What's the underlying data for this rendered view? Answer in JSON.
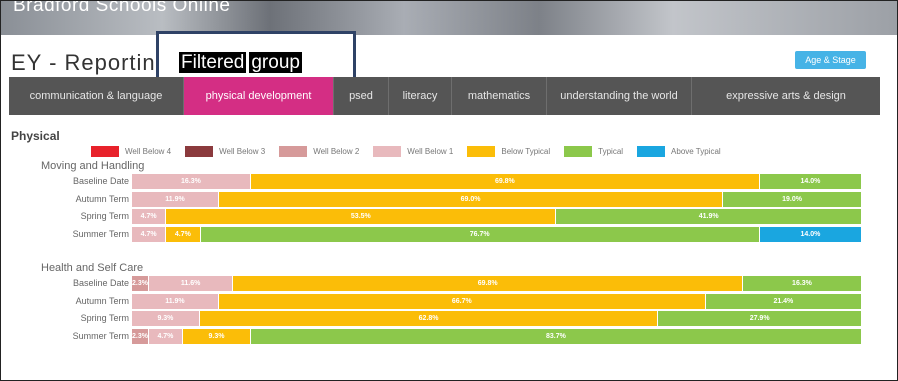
{
  "banner": {
    "site_name": "Bradford Schools Online"
  },
  "page": {
    "title": "EY - Reporting"
  },
  "callout": {
    "word1": "Filtered",
    "word2": "group"
  },
  "age_button": {
    "label": "Age & Stage"
  },
  "tabs": [
    {
      "label": "communication & language",
      "active": false
    },
    {
      "label": "physical development",
      "active": true
    },
    {
      "label": "psed",
      "active": false
    },
    {
      "label": "literacy",
      "active": false
    },
    {
      "label": "mathematics",
      "active": false
    },
    {
      "label": "understanding the world",
      "active": false
    },
    {
      "label": "expressive arts & design",
      "active": false
    }
  ],
  "section": {
    "title": "Physical"
  },
  "legend": [
    {
      "label": "Well Below 4",
      "color": "#e8222b"
    },
    {
      "label": "Well Below 3",
      "color": "#8b3a3d"
    },
    {
      "label": "Well Below 2",
      "color": "#d69a9a"
    },
    {
      "label": "Well Below 1",
      "color": "#e8b9bd"
    },
    {
      "label": "Below Typical",
      "color": "#fbbd08"
    },
    {
      "label": "Typical",
      "color": "#8cc84b"
    },
    {
      "label": "Above Typical",
      "color": "#1aa6e0"
    }
  ],
  "chart_data": {
    "type": "bar",
    "stacked": true,
    "orientation": "horizontal",
    "series_order": [
      "Well Below 4",
      "Well Below 3",
      "Well Below 2",
      "Well Below 1",
      "Below Typical",
      "Typical",
      "Above Typical"
    ],
    "groups": [
      {
        "name": "Moving and Handling",
        "rows": [
          {
            "label": "Baseline Date",
            "segments": [
              {
                "category": "Well Below 1",
                "value": 16.3,
                "text": "16.3%"
              },
              {
                "category": "Below Typical",
                "value": 69.8,
                "text": "69.8%"
              },
              {
                "category": "Typical",
                "value": 14.0,
                "text": "14.0%"
              }
            ]
          },
          {
            "label": "Autumn Term",
            "segments": [
              {
                "category": "Well Below 1",
                "value": 11.9,
                "text": "11.9%"
              },
              {
                "category": "Below Typical",
                "value": 69.0,
                "text": "69.0%"
              },
              {
                "category": "Typical",
                "value": 19.0,
                "text": "19.0%"
              }
            ]
          },
          {
            "label": "Spring Term",
            "segments": [
              {
                "category": "Well Below 1",
                "value": 4.7,
                "text": "4.7%"
              },
              {
                "category": "Below Typical",
                "value": 53.5,
                "text": "53.5%"
              },
              {
                "category": "Typical",
                "value": 41.9,
                "text": "41.9%"
              }
            ]
          },
          {
            "label": "Summer Term",
            "segments": [
              {
                "category": "Well Below 1",
                "value": 4.7,
                "text": "4.7%"
              },
              {
                "category": "Below Typical",
                "value": 4.7,
                "text": "4.7%"
              },
              {
                "category": "Typical",
                "value": 76.7,
                "text": "76.7%"
              },
              {
                "category": "Above Typical",
                "value": 14.0,
                "text": "14.0%"
              }
            ]
          }
        ]
      },
      {
        "name": "Health and Self Care",
        "rows": [
          {
            "label": "Baseline Date",
            "segments": [
              {
                "category": "Well Below 2",
                "value": 2.3,
                "text": "2.3%"
              },
              {
                "category": "Well Below 1",
                "value": 11.6,
                "text": "11.6%"
              },
              {
                "category": "Below Typical",
                "value": 69.8,
                "text": "69.8%"
              },
              {
                "category": "Typical",
                "value": 16.3,
                "text": "16.3%"
              }
            ]
          },
          {
            "label": "Autumn Term",
            "segments": [
              {
                "category": "Well Below 1",
                "value": 11.9,
                "text": "11.9%"
              },
              {
                "category": "Below Typical",
                "value": 66.7,
                "text": "66.7%"
              },
              {
                "category": "Typical",
                "value": 21.4,
                "text": "21.4%"
              }
            ]
          },
          {
            "label": "Spring Term",
            "segments": [
              {
                "category": "Well Below 1",
                "value": 9.3,
                "text": "9.3%"
              },
              {
                "category": "Below Typical",
                "value": 62.8,
                "text": "62.8%"
              },
              {
                "category": "Typical",
                "value": 27.9,
                "text": "27.9%"
              }
            ]
          },
          {
            "label": "Summer Term",
            "segments": [
              {
                "category": "Well Below 2",
                "value": 2.3,
                "text": "2.3%"
              },
              {
                "category": "Well Below 1",
                "value": 4.7,
                "text": "4.7%"
              },
              {
                "category": "Below Typical",
                "value": 9.3,
                "text": "9.3%"
              },
              {
                "category": "Typical",
                "value": 83.7,
                "text": "83.7%"
              }
            ]
          }
        ]
      }
    ]
  }
}
